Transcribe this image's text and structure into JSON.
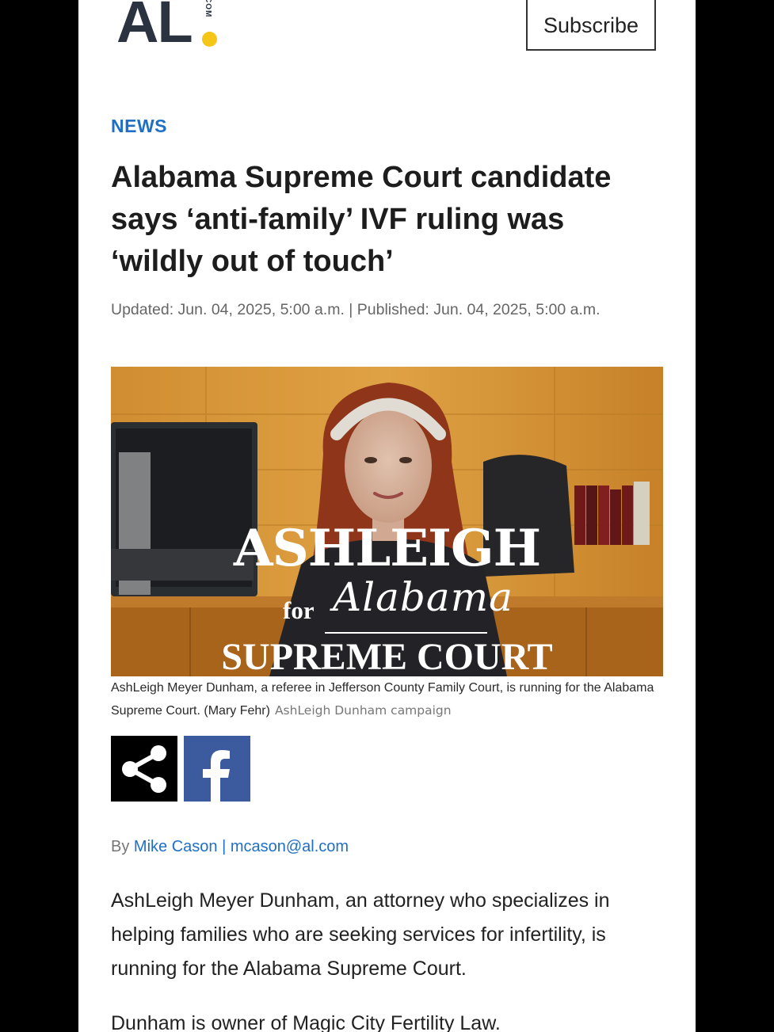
{
  "header": {
    "logo_text": "AL",
    "logo_suffix": "COM",
    "subscribe_label": "Subscribe"
  },
  "article": {
    "section": "NEWS",
    "headline": "Alabama Supreme Court candidate says ‘anti-family’ IVF ruling was ‘wildly out of touch’",
    "dateline": "Updated: Jun. 04, 2025, 5:00 a.m. | Published: Jun. 04, 2025, 5:00 a.m.",
    "image": {
      "overlay_name": "ASHLEIGH",
      "overlay_for": "for",
      "overlay_state": "Alabama",
      "overlay_court": "SUPREME COURT"
    },
    "caption": "AshLeigh Meyer Dunham, a referee in Jefferson County Family Court, is running for the Alabama Supreme Court. (Mary Fehr)",
    "credit": "AshLeigh Dunham campaign",
    "byline": {
      "prefix": "By",
      "author": "Mike Cason",
      "separator": "|",
      "email": "mcason@al.com"
    },
    "paragraphs": [
      "AshLeigh Meyer Dunham, an attorney who specializes in helping families who are seeking services for infertility, is running for the Alabama Supreme Court.",
      "Dunham is owner of Magic City Fertility Law."
    ]
  },
  "share": {
    "share_icon": "share-icon",
    "facebook_icon": "facebook-icon",
    "facebook_letter": "f"
  },
  "colors": {
    "link_blue": "#1f6fc5",
    "facebook_blue": "#3b5b9e",
    "logo_dot": "#f5c518",
    "logo_text": "#2b3341"
  }
}
